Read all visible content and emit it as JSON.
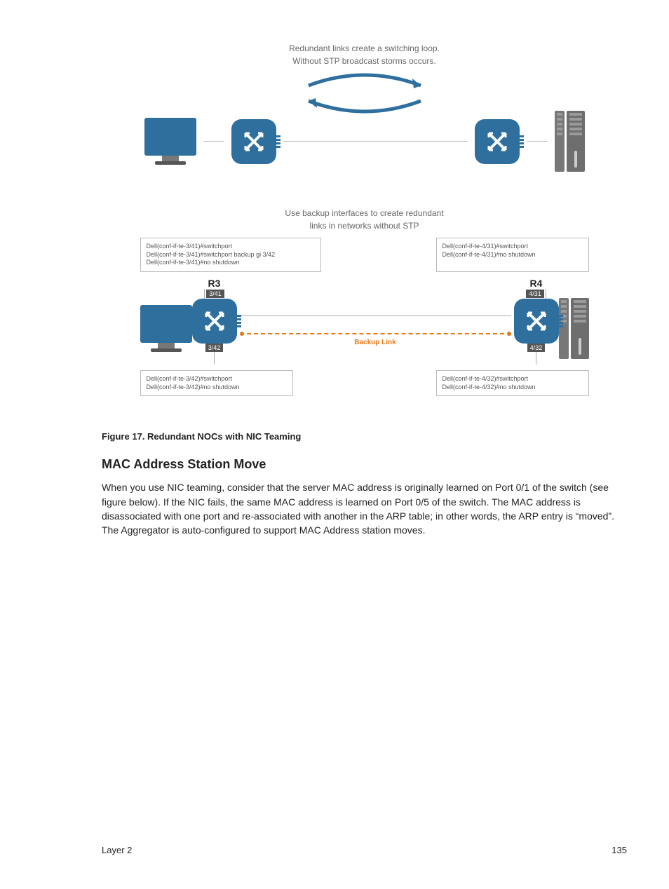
{
  "diagram": {
    "top_caption_1": "Redundant links create a switching loop.",
    "top_caption_2": "Without STP broadcast storms occurs.",
    "mid_caption_1": "Use backup interfaces to create redundant",
    "mid_caption_2": "links in networks without STP",
    "r3": {
      "label": "R3",
      "port_top": "3/41",
      "port_bottom": "3/42",
      "conf_top": "Dell(conf-if-te-3/41)#switchport\nDell(conf-if-te-3/41)#switchport backup gi 3/42\nDell(conf-if-te-3/41)#no shutdown",
      "conf_bottom": "Dell(conf-if-te-3/42)#switchport\nDell(conf-if-te-3/42)#no shutdown"
    },
    "r4": {
      "label": "R4",
      "port_top": "4/31",
      "port_bottom": "4/32",
      "conf_top": "Dell(conf-if-te-4/31)#switchport\nDell(conf-if-te-4/31)#no shutdown",
      "conf_bottom": "Dell(conf-if-te-4/32)#switchport\nDell(conf-if-te-4/32)#no shutdown"
    },
    "backup_link": "Backup Link"
  },
  "figure_caption": "Figure 17. Redundant NOCs with NIC Teaming",
  "heading": "MAC Address Station Move",
  "paragraph": "When you use NIC teaming, consider that the server MAC address is originally learned on Port 0/1 of the switch (see figure below). If the NIC fails, the same MAC address is learned on Port 0/5 of the switch. The MAC address is disassociated with one port and re-associated with another in the ARP table; in other words, the ARP entry is “moved”. The Aggregator is auto-configured to support MAC Address station moves.",
  "footer": {
    "section": "Layer 2",
    "page": "135"
  }
}
